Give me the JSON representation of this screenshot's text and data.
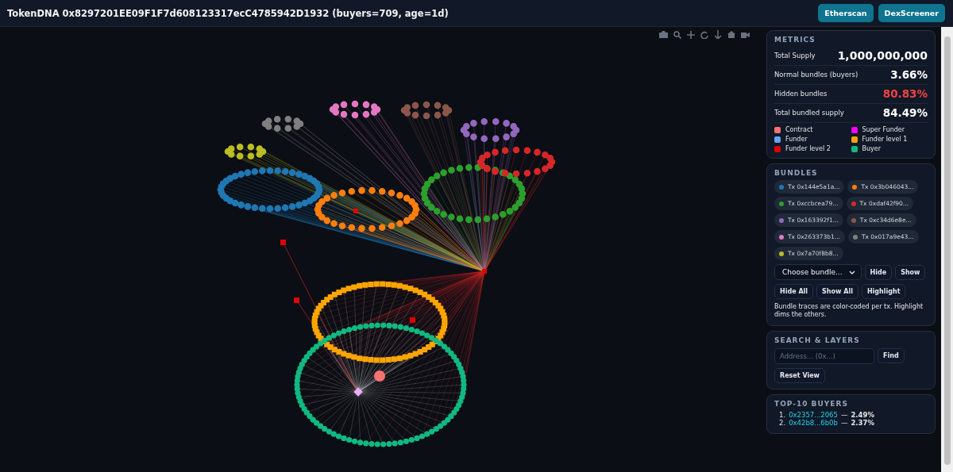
{
  "header": {
    "title": "TokenDNA 0x8297201EE09F1F7d608123317ecC4785942D1932 (buyers=709, age=1d)",
    "buttons": [
      "Etherscan",
      "DexScreener"
    ]
  },
  "metrics": {
    "title": "METRICS",
    "rows": [
      {
        "label": "Total Supply",
        "value": "1,000,000,000",
        "alert": false
      },
      {
        "label": "Normal bundles (buyers)",
        "value": "3.66%",
        "alert": false
      },
      {
        "label": "Hidden bundles",
        "value": "80.83%",
        "alert": true
      },
      {
        "label": "Total bundled supply",
        "value": "84.49%",
        "alert": false
      }
    ],
    "legend": [
      {
        "label": "Contract",
        "color": "#f87171"
      },
      {
        "label": "Super Funder",
        "color": "#ff00ff"
      },
      {
        "label": "Funder",
        "color": "#60a5fa"
      },
      {
        "label": "Funder level 1",
        "color": "#ffa500"
      },
      {
        "label": "Funder level 2",
        "color": "#e10000"
      },
      {
        "label": "Buyer",
        "color": "#10b981"
      }
    ]
  },
  "bundles": {
    "title": "BUNDLES",
    "chips": [
      {
        "label": "Tx 0x144e5a1a...",
        "color": "#1f77b4"
      },
      {
        "label": "Tx 0x3b046043...",
        "color": "#ff7f0e"
      },
      {
        "label": "Tx 0xccbcea79...",
        "color": "#2ca02c"
      },
      {
        "label": "Tx 0xdaf42f90...",
        "color": "#d62728"
      },
      {
        "label": "Tx 0x163392f1...",
        "color": "#9467bd"
      },
      {
        "label": "Tx 0xc34d6e8e...",
        "color": "#8c564b"
      },
      {
        "label": "Tx 0x263373b1...",
        "color": "#e377c2"
      },
      {
        "label": "Tx 0x017a9e43...",
        "color": "#7f7f7f"
      },
      {
        "label": "Tx 0x7a70f8b8...",
        "color": "#bcbd22"
      }
    ],
    "select": "Choose bundle...",
    "row_buttons": [
      "Hide",
      "Show"
    ],
    "buttons": [
      "Hide All",
      "Show All",
      "Highlight"
    ],
    "note": "Bundle traces are color-coded per tx. Highlight dims the others."
  },
  "search": {
    "title": "SEARCH & LAYERS",
    "placeholder": "Address... (0x...)",
    "find": "Find",
    "reset": "Reset View"
  },
  "top_buyers": {
    "title": "TOP-10 BUYERS",
    "items": [
      {
        "rank": "1.",
        "address": "0x2357...2065",
        "separator": "—",
        "share": "2.49%"
      },
      {
        "rank": "2.",
        "address": "0x42b8...6b0b",
        "separator": "—",
        "share": "2.37%"
      }
    ]
  }
}
